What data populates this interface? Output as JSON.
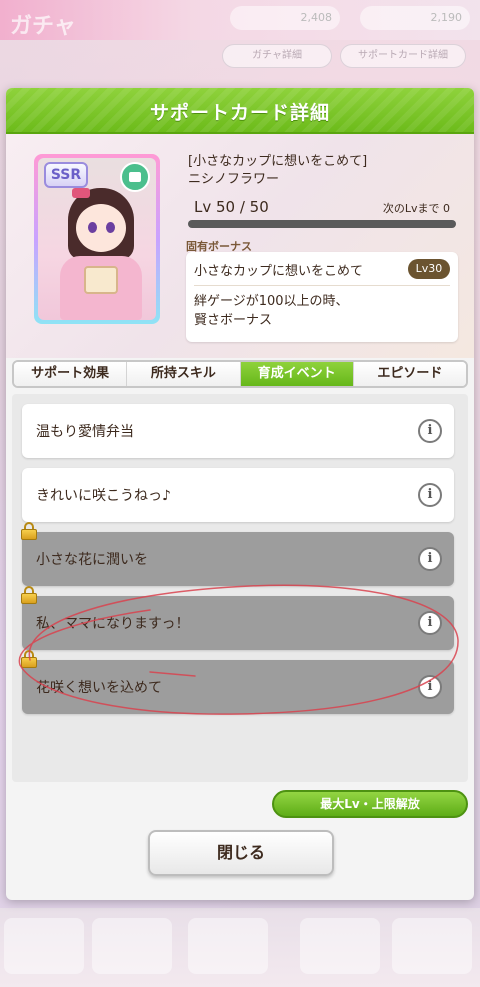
{
  "background": {
    "title": "ガチャ",
    "counter1": "2,408",
    "counter2": "2,190",
    "pill1": "ガチャ詳細",
    "pill2": "サポートカード詳細",
    "nav": [
      "",
      "",
      "",
      "",
      "",
      ""
    ]
  },
  "dialog": {
    "title": "サポートカード詳細",
    "card": {
      "rarity": "SSR",
      "title": "[小さなカップに想いをこめて]",
      "chara": "ニシノフラワー",
      "level": "Lv 50 / 50",
      "next_level": "次のLvまで 0",
      "level_progress": 1.0
    },
    "bonus": {
      "heading": "固有ボーナス",
      "name": "小さなカップに想いをこめて",
      "unlock_level": "Lv30",
      "description": "絆ゲージが100以上の時、\n賢さボーナス"
    },
    "tabs": [
      {
        "label": "サポート効果",
        "active": false
      },
      {
        "label": "所持スキル",
        "active": false
      },
      {
        "label": "育成イベント",
        "active": true
      },
      {
        "label": "エピソード",
        "active": false
      }
    ],
    "events": [
      {
        "label": "温もり愛情弁当",
        "locked": false
      },
      {
        "label": "きれいに咲こうねっ♪",
        "locked": false
      },
      {
        "label": "小さな花に潤いを",
        "locked": true
      },
      {
        "label": "私、ママになりますっ！",
        "locked": true
      },
      {
        "label": "花咲く想いを込めて",
        "locked": true
      }
    ],
    "info_symbol": "i",
    "max_level_button": "最大Lv・上限解放",
    "close_button": "閉じる"
  },
  "colors": {
    "accent_green": "#6cbb1a",
    "locked_row": "#9d9d9d",
    "annotation_red": "#d9434f"
  }
}
